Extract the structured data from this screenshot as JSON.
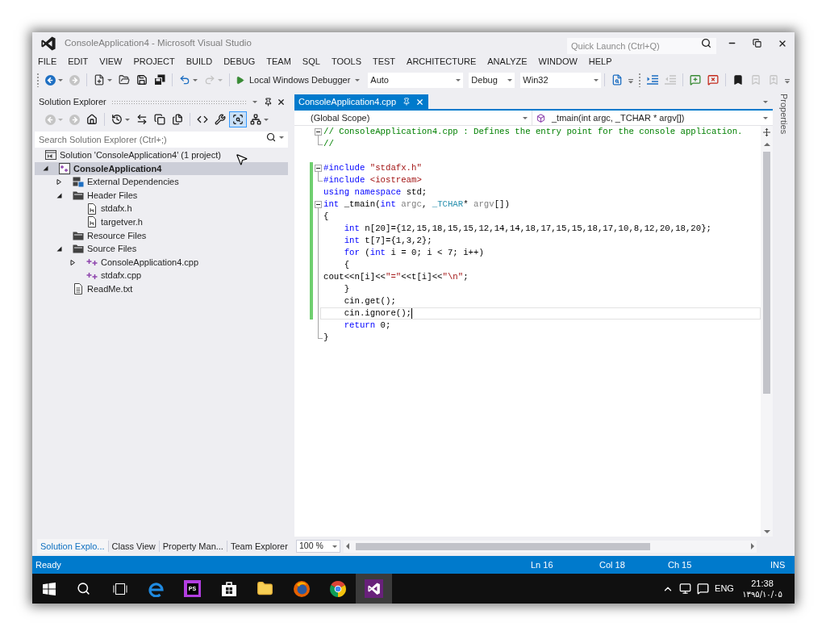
{
  "window": {
    "title": "ConsoleApplication4 - Microsoft Visual Studio"
  },
  "quick_launch": {
    "placeholder": "Quick Launch (Ctrl+Q)"
  },
  "menu": [
    "FILE",
    "EDIT",
    "VIEW",
    "PROJECT",
    "BUILD",
    "DEBUG",
    "TEAM",
    "SQL",
    "TOOLS",
    "TEST",
    "ARCHITECTURE",
    "ANALYZE",
    "WINDOW",
    "HELP"
  ],
  "toolbar": {
    "groups": [
      [
        {
          "kind": "back",
          "disabled": false
        },
        {
          "kind": "forward",
          "disabled": true
        }
      ],
      [
        {
          "kind": "new-item",
          "disabled": false
        },
        {
          "kind": "open",
          "disabled": false
        },
        {
          "kind": "save",
          "disabled": false
        },
        {
          "kind": "save-all",
          "disabled": false
        }
      ],
      [
        {
          "kind": "undo",
          "disabled": false
        },
        {
          "kind": "redo",
          "disabled": true
        }
      ]
    ],
    "start_button": {
      "label": "Local Windows Debugger"
    },
    "combos": [
      {
        "value": "Auto"
      },
      {
        "value": "Debug"
      },
      {
        "value": "Win32"
      }
    ],
    "more_groups": [
      [
        {
          "kind": "find-in-files",
          "disabled": false
        }
      ],
      [
        {
          "kind": "indent",
          "disabled": false
        },
        {
          "kind": "outdent",
          "disabled": true
        }
      ],
      [
        {
          "kind": "comment",
          "disabled": false
        },
        {
          "kind": "uncomment",
          "disabled": false
        }
      ],
      [
        {
          "kind": "bookmark",
          "disabled": false
        },
        {
          "kind": "prev-bookmark",
          "disabled": true
        },
        {
          "kind": "next-bookmark",
          "disabled": true
        }
      ]
    ]
  },
  "solution_explorer": {
    "title": "Solution Explorer",
    "toolbar": [
      [
        {
          "kind": "back",
          "disabled": true,
          "on": false
        },
        {
          "kind": "forward",
          "disabled": true,
          "on": false
        },
        {
          "kind": "home",
          "disabled": false,
          "on": false
        }
      ],
      [
        {
          "kind": "history",
          "disabled": false,
          "on": false
        },
        {
          "kind": "sync",
          "disabled": false,
          "on": false
        },
        {
          "kind": "collapse-all",
          "disabled": false,
          "on": false
        },
        {
          "kind": "show-all",
          "disabled": false,
          "on": false
        }
      ],
      [
        {
          "kind": "view-code",
          "disabled": false,
          "on": false
        },
        {
          "kind": "properties",
          "disabled": false,
          "on": false
        },
        {
          "kind": "preview",
          "disabled": false,
          "on": true
        },
        {
          "kind": "class-diagram",
          "disabled": false,
          "on": false
        }
      ]
    ],
    "search": {
      "placeholder": "Search Solution Explorer (Ctrl+;)"
    },
    "tree": [
      {
        "label": "Solution 'ConsoleApplication4' (1 project)",
        "kind": "solution",
        "selected": false,
        "children": [
          {
            "label": "ConsoleApplication4",
            "kind": "project",
            "selected": true,
            "expanded": true,
            "children": [
              {
                "label": "External Dependencies",
                "kind": "dependencies",
                "selected": false,
                "expanded": false
              },
              {
                "label": "Header Files",
                "kind": "folder",
                "selected": false,
                "expanded": true,
                "children": [
                  {
                    "label": "stdafx.h",
                    "kind": "header",
                    "selected": false
                  },
                  {
                    "label": "targetver.h",
                    "kind": "header",
                    "selected": false
                  }
                ]
              },
              {
                "label": "Resource Files",
                "kind": "folder",
                "selected": false
              },
              {
                "label": "Source Files",
                "kind": "folder",
                "selected": false,
                "expanded": true,
                "children": [
                  {
                    "label": "ConsoleApplication4.cpp",
                    "kind": "source",
                    "selected": false,
                    "expanded": false
                  },
                  {
                    "label": "stdafx.cpp",
                    "kind": "source",
                    "selected": false
                  }
                ]
              },
              {
                "label": "ReadMe.txt",
                "kind": "text",
                "selected": false
              }
            ]
          }
        ]
      }
    ]
  },
  "panel_tabs": [
    {
      "label": "Solution Explo...",
      "selected": true
    },
    {
      "label": "Class View",
      "selected": false
    },
    {
      "label": "Property Man...",
      "selected": false
    },
    {
      "label": "Team Explorer",
      "selected": false
    }
  ],
  "editor": {
    "tabs": [
      {
        "label": "ConsoleApplication4.cpp",
        "selected": true
      }
    ],
    "scope": "(Global Scope)",
    "member": "_tmain(int argc, _TCHAR * argv[])",
    "lines": [
      {
        "kind": "fold-start",
        "changed": false,
        "current": false,
        "tokens": [
          {
            "kind": "comment",
            "text": "// ConsoleApplication4.cpp : Defines the entry point for the console application."
          }
        ]
      },
      {
        "kind": "fold-end",
        "changed": false,
        "current": false,
        "tokens": [
          {
            "kind": "comment",
            "text": "//"
          }
        ]
      },
      {
        "kind": "plain",
        "changed": false,
        "current": false
      },
      {
        "kind": "fold-start",
        "changed": true,
        "current": false,
        "tokens": [
          {
            "kind": "keyword",
            "text": "#include"
          },
          {
            "kind": "string",
            "text": " \"stdafx.h\""
          }
        ]
      },
      {
        "kind": "fold-end",
        "changed": true,
        "current": false,
        "tokens": [
          {
            "kind": "keyword",
            "text": "#include"
          },
          {
            "kind": "string",
            "text": " <iostream>"
          }
        ]
      },
      {
        "kind": "plain",
        "changed": true,
        "current": false,
        "tokens": [
          {
            "kind": "keyword",
            "text": "using namespace"
          },
          {
            "kind": "plain",
            "text": " std;"
          }
        ]
      },
      {
        "kind": "fold-start",
        "changed": true,
        "current": false,
        "tokens": [
          {
            "kind": "keyword",
            "text": "int"
          },
          {
            "kind": "plain",
            "text": " _tmain("
          },
          {
            "kind": "keyword",
            "text": "int"
          },
          {
            "kind": "param",
            "text": " argc"
          },
          {
            "kind": "plain",
            "text": ", "
          },
          {
            "kind": "type",
            "text": "_TCHAR"
          },
          {
            "kind": "plain",
            "text": "* "
          },
          {
            "kind": "param",
            "text": "argv"
          },
          {
            "kind": "plain",
            "text": "[])"
          }
        ]
      },
      {
        "kind": "fold-inner",
        "changed": true,
        "current": false,
        "tokens": [
          {
            "kind": "plain",
            "text": "{"
          }
        ]
      },
      {
        "kind": "fold-inner",
        "changed": true,
        "current": false,
        "tokens": [
          {
            "kind": "keyword",
            "text": "    int"
          },
          {
            "kind": "plain",
            "text": " n[20]={12,15,18,15,15,12,14,14,18,17,15,15,18,17,10,8,12,20,18,20};"
          }
        ]
      },
      {
        "kind": "fold-inner",
        "changed": true,
        "current": false,
        "tokens": [
          {
            "kind": "keyword",
            "text": "    int"
          },
          {
            "kind": "plain",
            "text": " t[7]={1,3,2};"
          }
        ]
      },
      {
        "kind": "fold-inner",
        "changed": true,
        "current": false,
        "tokens": [
          {
            "kind": "keyword",
            "text": "    for"
          },
          {
            "kind": "plain",
            "text": " ("
          },
          {
            "kind": "keyword",
            "text": "int"
          },
          {
            "kind": "plain",
            "text": " i = 0; i < 7; i++)"
          }
        ]
      },
      {
        "kind": "fold-inner",
        "changed": true,
        "current": false,
        "tokens": [
          {
            "kind": "plain",
            "text": "    {"
          }
        ]
      },
      {
        "kind": "fold-inner",
        "changed": true,
        "current": false,
        "tokens": [
          {
            "kind": "plain",
            "text": "cout<<n[i]<<"
          },
          {
            "kind": "string",
            "text": "\"=\""
          },
          {
            "kind": "plain",
            "text": "<<t[i]<<"
          },
          {
            "kind": "string",
            "text": "\"\\n\""
          },
          {
            "kind": "plain",
            "text": ";"
          }
        ]
      },
      {
        "kind": "fold-inner",
        "changed": true,
        "current": false,
        "tokens": [
          {
            "kind": "plain",
            "text": "    }"
          }
        ]
      },
      {
        "kind": "fold-inner",
        "changed": true,
        "current": false,
        "tokens": [
          {
            "kind": "plain",
            "text": "    cin.get();"
          }
        ]
      },
      {
        "kind": "fold-inner",
        "changed": true,
        "current": true,
        "tokens": [
          {
            "kind": "plain",
            "text": "    cin.ignore();"
          }
        ]
      },
      {
        "kind": "fold-inner",
        "changed": false,
        "current": false,
        "tokens": [
          {
            "kind": "keyword",
            "text": "    return"
          },
          {
            "kind": "plain",
            "text": " 0;"
          }
        ]
      },
      {
        "kind": "fold-end",
        "changed": false,
        "current": false,
        "tokens": [
          {
            "kind": "plain",
            "text": "}"
          }
        ]
      }
    ],
    "zoom": "100 %"
  },
  "properties_tab": {
    "label": "Properties"
  },
  "status_bar": {
    "message": "Ready",
    "line": "Ln 16",
    "column": "Col 18",
    "char": "Ch 15",
    "mode": "INS"
  },
  "taskbar": {
    "items": [
      {
        "kind": "start",
        "selected": false
      },
      {
        "kind": "search",
        "selected": false
      },
      {
        "kind": "task-view",
        "selected": false
      },
      {
        "kind": "edge",
        "selected": false
      },
      {
        "kind": "ps",
        "label": "PS",
        "selected": false
      },
      {
        "kind": "store",
        "selected": false
      },
      {
        "kind": "files",
        "selected": false
      },
      {
        "kind": "firefox",
        "selected": false
      },
      {
        "kind": "chrome",
        "selected": false
      },
      {
        "kind": "vs",
        "selected": true
      }
    ],
    "tray": {
      "language": "ENG",
      "time": "21:38",
      "date": "۱۳۹۵/۱۰/۰۵"
    }
  }
}
